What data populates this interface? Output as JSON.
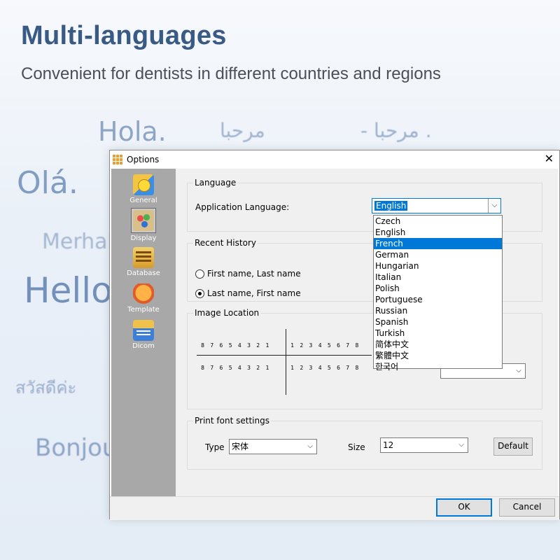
{
  "banner": {
    "headline": "Multi-languages",
    "subline": "Convenient for dentists in different countries and regions"
  },
  "greetings": {
    "hola": "Hola.",
    "arabic1": "مرحبا",
    "arabic2": "- مرحبا .",
    "ola": "Olá.",
    "merhaba": "Merhab",
    "hello": "Hello",
    "thai": "สวัสดีค่ะ",
    "bonjour": "Bonjou"
  },
  "window": {
    "title": "Options",
    "close_glyph": "✕"
  },
  "sidebar": {
    "items": [
      {
        "label": "General",
        "icon": "general-icon"
      },
      {
        "label": "Display",
        "icon": "palette-icon",
        "selected": true
      },
      {
        "label": "Database",
        "icon": "database-icon"
      },
      {
        "label": "Template",
        "icon": "mask-icon"
      },
      {
        "label": "Dicom",
        "icon": "dicom-icon"
      }
    ]
  },
  "language": {
    "group_title": "Language",
    "app_language_label": "Application Language:",
    "selected": "English",
    "options": [
      "Czech",
      "English",
      "French",
      "German",
      "Hungarian",
      "Italian",
      "Polish",
      "Portuguese",
      "Russian",
      "Spanish",
      "Turkish",
      "简体中文",
      "繁體中文",
      "한국어"
    ],
    "highlighted": "French"
  },
  "recent_history": {
    "group_title": "Recent History",
    "option1": "First name, Last name",
    "option2": "Last name, First name",
    "selected": 2
  },
  "image_location": {
    "group_title": "Image Location",
    "left_teeth": [
      "8",
      "7",
      "6",
      "5",
      "4",
      "3",
      "2",
      "1"
    ],
    "right_teeth": [
      "1",
      "2",
      "3",
      "4",
      "5",
      "6",
      "7",
      "8"
    ]
  },
  "print_font": {
    "group_title": "Print font settings",
    "type_label": "Type",
    "type_value": "宋体",
    "size_label": "Size",
    "size_value": "12",
    "default_button": "Default"
  },
  "footer": {
    "ok": "OK",
    "cancel": "Cancel"
  },
  "colors": {
    "accent": "#0078d7",
    "headline": "#3a5a86",
    "sidebar": "#a8a8a8"
  }
}
